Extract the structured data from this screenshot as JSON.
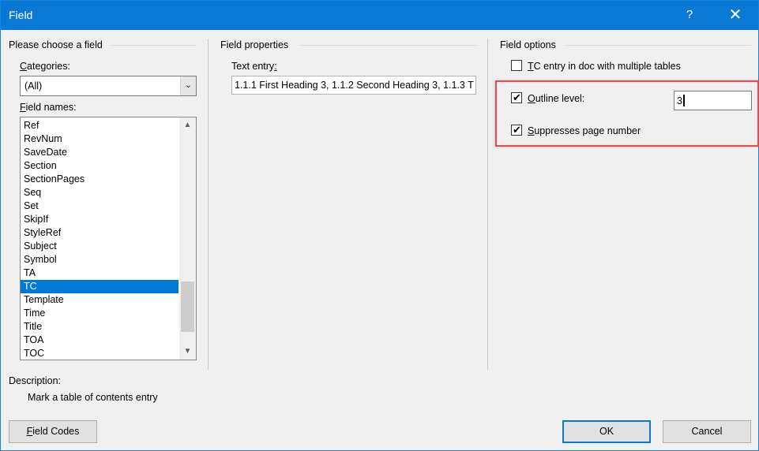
{
  "window": {
    "title": "Field",
    "help_icon": "?",
    "close_icon": "✕"
  },
  "left": {
    "group_title": "Please choose a field",
    "categories_label_accel": "C",
    "categories_label_rest": "ategories:",
    "categories_value": "(All)",
    "field_names_label_accel": "F",
    "field_names_label_rest": "ield names:",
    "field_names": [
      "Ref",
      "RevNum",
      "SaveDate",
      "Section",
      "SectionPages",
      "Seq",
      "Set",
      "SkipIf",
      "StyleRef",
      "Subject",
      "Symbol",
      "TA",
      "TC",
      "Template",
      "Time",
      "Title",
      "TOA",
      "TOC"
    ],
    "selected_field": "TC"
  },
  "middle": {
    "group_title": "Field properties",
    "text_entry_label_rest": "Text entry",
    "text_entry_label_accel": ":",
    "text_entry_value": "1.1.1 First Heading 3, 1.1.2 Second Heading 3, 1.1.3 T"
  },
  "right": {
    "group_title": "Field options",
    "tc_multiple_accel": "T",
    "tc_multiple_rest": "C entry in doc with multiple tables",
    "tc_multiple_checked": false,
    "outline_accel": "O",
    "outline_rest": "utline level:",
    "outline_checked": true,
    "outline_value": "3",
    "suppress_accel": "S",
    "suppress_rest": "uppresses page number",
    "suppress_checked": true
  },
  "description": {
    "label": "Description:",
    "text": "Mark a table of contents entry"
  },
  "buttons": {
    "field_codes_accel": "F",
    "field_codes_rest": "ield Codes",
    "ok": "OK",
    "cancel": "Cancel"
  },
  "colors": {
    "titlebar": "#0a79d6",
    "selection": "#0078d7",
    "highlight_box": "#e54b4b"
  }
}
